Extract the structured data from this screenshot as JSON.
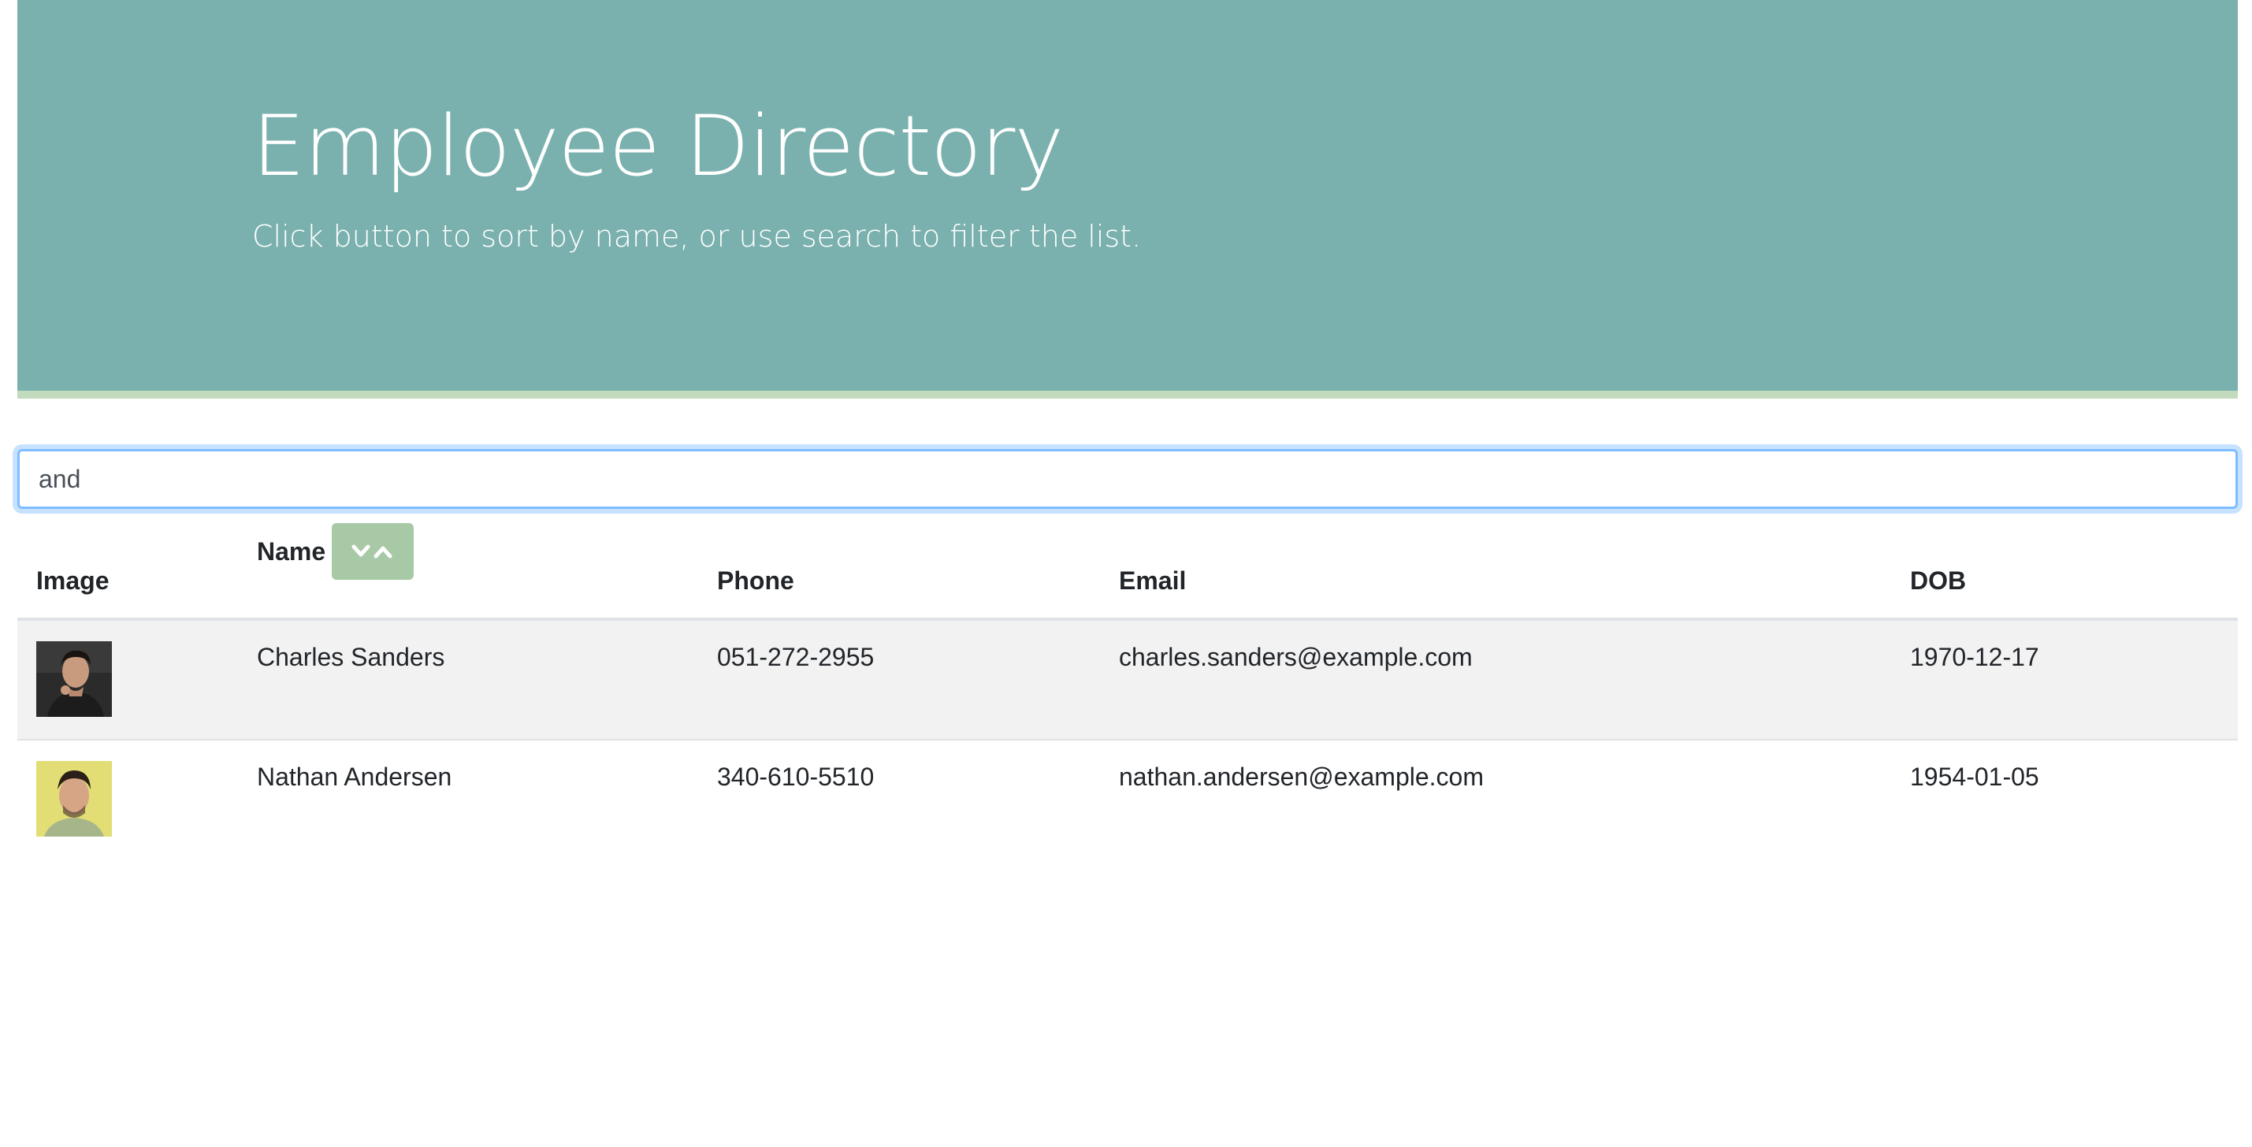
{
  "header": {
    "title": "Employee Directory",
    "subtitle": "Click button to sort by name, or use search to filter the list."
  },
  "search": {
    "value": "and",
    "placeholder": ""
  },
  "table": {
    "columns": {
      "image": "Image",
      "name": "Name",
      "phone": "Phone",
      "email": "Email",
      "dob": "DOB"
    },
    "sort_button_icon": "chevron-down-up-icon",
    "rows": [
      {
        "avatar_icon": "employee-photo",
        "name": "Charles Sanders",
        "phone": "051-272-2955",
        "email": "charles.sanders@example.com",
        "dob": "1970-12-17"
      },
      {
        "avatar_icon": "employee-photo",
        "name": "Nathan Andersen",
        "phone": "340-610-5510",
        "email": "nathan.andersen@example.com",
        "dob": "1954-01-05"
      }
    ]
  },
  "colors": {
    "header_bg": "#7ab1ae",
    "header_border": "#c3dbbd",
    "sort_button": "#a8c9a6",
    "stripe": "#f2f2f2"
  }
}
